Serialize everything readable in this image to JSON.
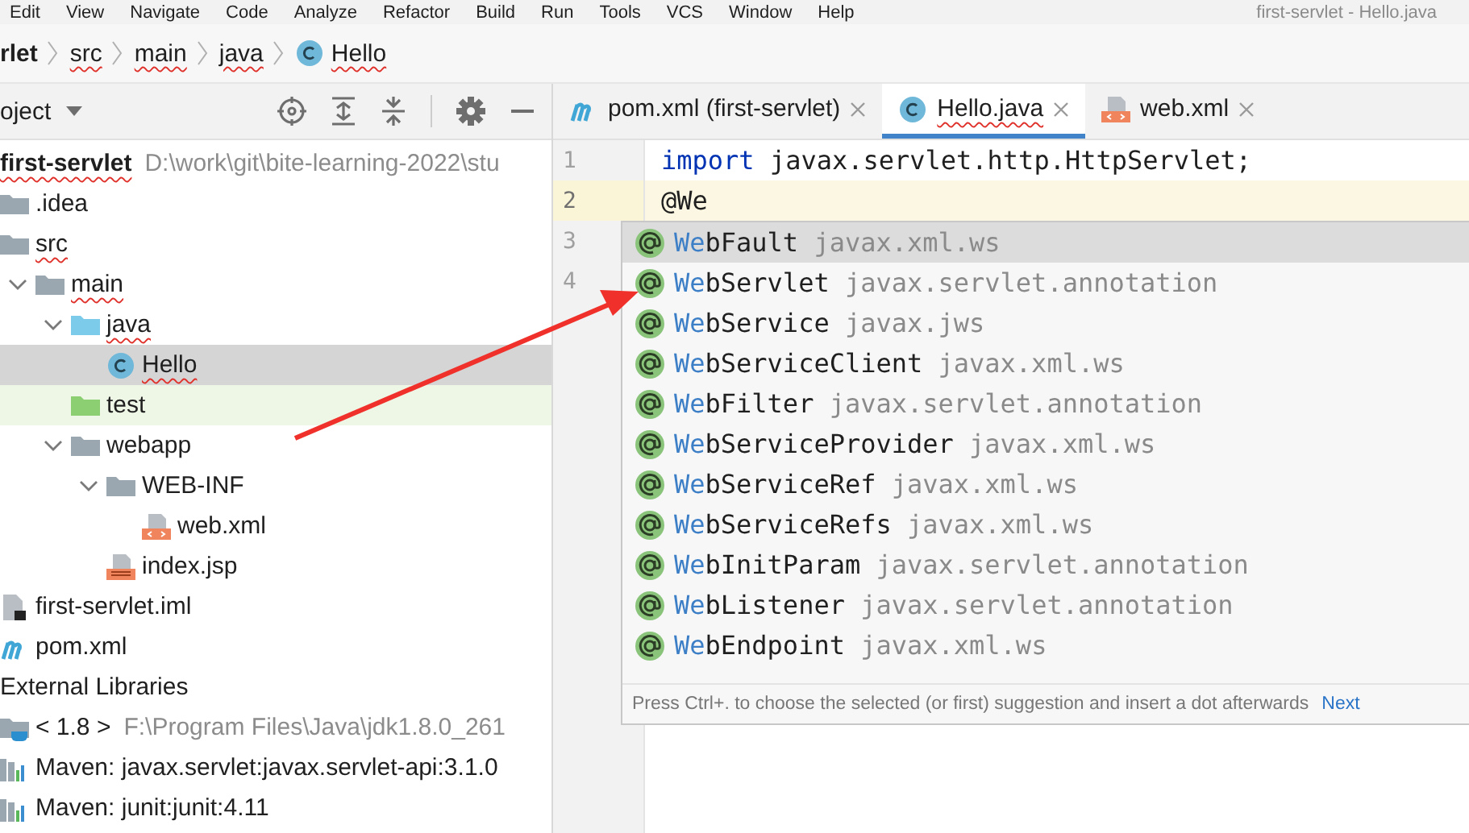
{
  "menu_bar": {
    "items": [
      "Edit",
      "View",
      "Navigate",
      "Code",
      "Analyze",
      "Refactor",
      "Build",
      "Run",
      "Tools",
      "VCS",
      "Window",
      "Help"
    ],
    "window_title": "first-servlet - Hello.java"
  },
  "breadcrumb": [
    {
      "label": "rlet",
      "kind": "module",
      "misspelled": false
    },
    {
      "label": "src",
      "kind": "folder",
      "misspelled": true
    },
    {
      "label": "main",
      "kind": "folder",
      "misspelled": true
    },
    {
      "label": "java",
      "kind": "folder",
      "misspelled": true
    },
    {
      "label": "Hello",
      "kind": "class",
      "misspelled": true
    }
  ],
  "project_panel": {
    "title": "oject",
    "tree": [
      {
        "label": "first-servlet",
        "kind": "module",
        "path": "D:\\work\\git\\bite-learning-2022\\stu",
        "misspelled": true,
        "selected": false,
        "children": [
          {
            "label": ".idea",
            "kind": "folder",
            "misspelled": false,
            "selected": false
          },
          {
            "label": "src",
            "kind": "folder",
            "misspelled": true,
            "selected": false,
            "children": [
              {
                "label": "main",
                "kind": "folder",
                "expanded": true,
                "misspelled": true,
                "selected": false,
                "children": [
                  {
                    "label": "java",
                    "kind": "source-folder",
                    "expanded": true,
                    "misspelled": true,
                    "selected": false,
                    "children": [
                      {
                        "label": "Hello",
                        "kind": "class",
                        "misspelled": true,
                        "selected": true
                      }
                    ]
                  },
                  {
                    "label": "test",
                    "kind": "test-folder",
                    "misspelled": false,
                    "selected": false
                  },
                  {
                    "label": "webapp",
                    "kind": "folder",
                    "expanded": true,
                    "misspelled": false,
                    "selected": false,
                    "children": [
                      {
                        "label": "WEB-INF",
                        "kind": "folder",
                        "expanded": true,
                        "misspelled": false,
                        "selected": false,
                        "children": [
                          {
                            "label": "web.xml",
                            "kind": "xml",
                            "misspelled": false,
                            "selected": false
                          }
                        ]
                      },
                      {
                        "label": "index.jsp",
                        "kind": "jsp",
                        "misspelled": false,
                        "selected": false
                      }
                    ]
                  }
                ]
              }
            ]
          },
          {
            "label": "first-servlet.iml",
            "kind": "iml",
            "misspelled": false,
            "selected": false
          },
          {
            "label": "pom.xml",
            "kind": "maven",
            "misspelled": false,
            "selected": false
          }
        ]
      },
      {
        "label": "External Libraries",
        "kind": "group",
        "misspelled": false,
        "selected": false,
        "children": [
          {
            "label": "< 1.8 >",
            "kind": "jdk",
            "path": "F:\\Program Files\\Java\\jdk1.8.0_261",
            "misspelled": false,
            "selected": false
          },
          {
            "label": "Maven: javax.servlet:javax.servlet-api:3.1.0",
            "kind": "library",
            "misspelled": false,
            "selected": false
          },
          {
            "label": "Maven: junit:junit:4.11",
            "kind": "library",
            "misspelled": false,
            "selected": false
          }
        ]
      }
    ]
  },
  "editor_tabs": [
    {
      "label": "pom.xml (first-servlet)",
      "kind": "maven",
      "selected": false,
      "misspelled": false
    },
    {
      "label": "Hello.java",
      "kind": "class",
      "selected": true,
      "misspelled": true
    },
    {
      "label": "web.xml",
      "kind": "xml",
      "selected": false,
      "misspelled": false
    }
  ],
  "editor": {
    "lines": [
      {
        "number": "1",
        "current": false,
        "tokens": [
          {
            "kind": "keyword",
            "text": "import"
          },
          {
            "kind": "plain",
            "text": " javax.servlet.http.HttpServlet;"
          }
        ]
      },
      {
        "number": "2",
        "current": true,
        "tokens": [
          {
            "kind": "plain",
            "text": "@We"
          }
        ]
      },
      {
        "number": "3",
        "current": false
      },
      {
        "number": "4",
        "current": false
      }
    ]
  },
  "completion_popup": {
    "items": [
      {
        "match": "We",
        "name": "bFault",
        "package": "javax.xml.ws",
        "selected": true
      },
      {
        "match": "We",
        "name": "bServlet",
        "package": "javax.servlet.annotation",
        "selected": false
      },
      {
        "match": "We",
        "name": "bService",
        "package": "javax.jws",
        "selected": false
      },
      {
        "match": "We",
        "name": "bServiceClient",
        "package": "javax.xml.ws",
        "selected": false
      },
      {
        "match": "We",
        "name": "bFilter",
        "package": "javax.servlet.annotation",
        "selected": false
      },
      {
        "match": "We",
        "name": "bServiceProvider",
        "package": "javax.xml.ws",
        "selected": false
      },
      {
        "match": "We",
        "name": "bServiceRef",
        "package": "javax.xml.ws",
        "selected": false
      },
      {
        "match": "We",
        "name": "bServiceRefs",
        "package": "javax.xml.ws",
        "selected": false
      },
      {
        "match": "We",
        "name": "bInitParam",
        "package": "javax.servlet.annotation",
        "selected": false
      },
      {
        "match": "We",
        "name": "bListener",
        "package": "javax.servlet.annotation",
        "selected": false
      },
      {
        "match": "We",
        "name": "bEndpoint",
        "package": "javax.xml.ws",
        "selected": false
      }
    ],
    "hint": "Press Ctrl+. to choose the selected (or first) suggestion and insert a dot afterwards",
    "link": "Next"
  },
  "annotation": {
    "kind": "arrow"
  }
}
